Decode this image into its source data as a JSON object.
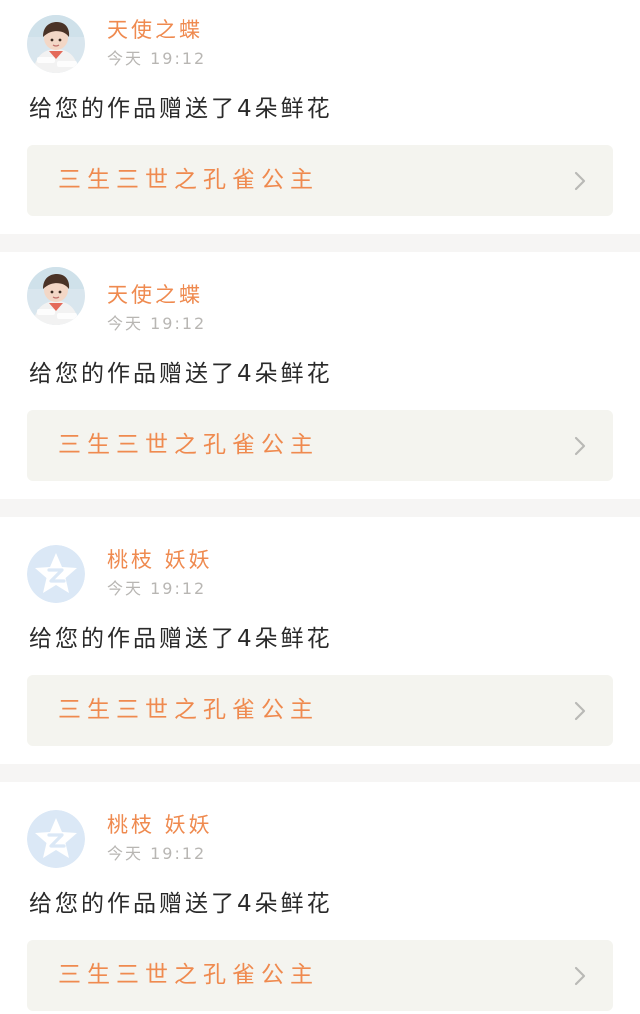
{
  "notifications": [
    {
      "user_name": "天使之蝶",
      "avatar_icon": "photo-avatar-icon",
      "timestamp": "今天 19:12",
      "message": "给您的作品赠送了4朵鲜花",
      "work_title": "三生三世之孔雀公主"
    },
    {
      "user_name": "天使之蝶",
      "avatar_icon": "photo-avatar-icon",
      "timestamp": "今天 19:12",
      "message": "给您的作品赠送了4朵鲜花",
      "work_title": "三生三世之孔雀公主"
    },
    {
      "user_name": "桃枝 妖妖",
      "avatar_icon": "default-qzone-avatar-icon",
      "timestamp": "今天 19:12",
      "message": "给您的作品赠送了4朵鲜花",
      "work_title": "三生三世之孔雀公主"
    },
    {
      "user_name": "桃枝 妖妖",
      "avatar_icon": "default-qzone-avatar-icon",
      "timestamp": "今天 19:12",
      "message": "给您的作品赠送了4朵鲜花",
      "work_title": "三生三世之孔雀公主"
    }
  ],
  "colors": {
    "accent": "#ef8a4f",
    "timestamp": "#b8b6b3",
    "message": "#2a2a2a",
    "link_background": "#f4f4ef",
    "separator": "#f6f5f4",
    "default_avatar": "#dbe8f6"
  }
}
